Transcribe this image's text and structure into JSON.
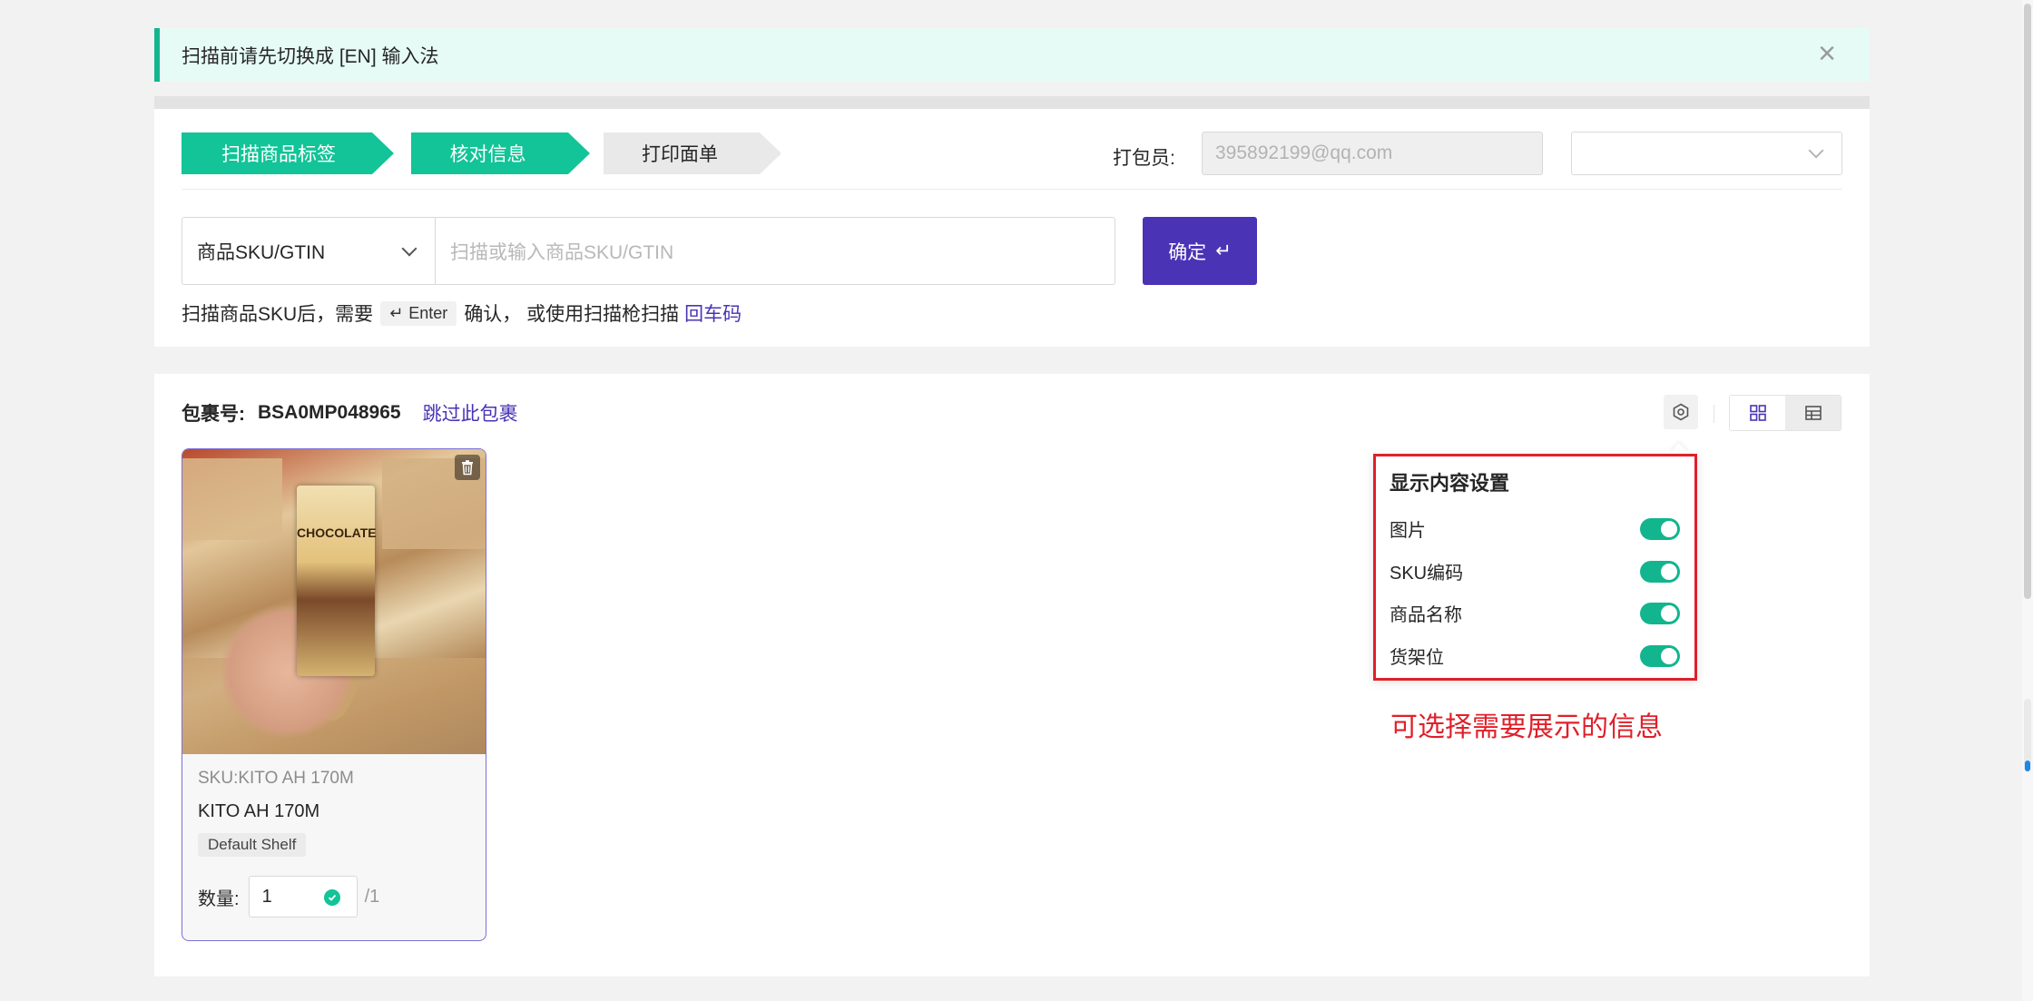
{
  "banner": {
    "text": "扫描前请先切换成 [EN] 输入法",
    "close": "×"
  },
  "steps": [
    {
      "label": "扫描商品标签",
      "state": "done"
    },
    {
      "label": "核对信息",
      "state": "active"
    },
    {
      "label": "打印面单",
      "state": "pending"
    }
  ],
  "packer": {
    "label": "打包员:",
    "value": "395892199@qq.com",
    "select_value": ""
  },
  "scan": {
    "type_select": "商品SKU/GTIN",
    "placeholder": "扫描或输入商品SKU/GTIN",
    "confirm_label": "确定",
    "confirm_icon": "↵",
    "hint_prefix": "扫描商品SKU后，需要",
    "hint_key": "Enter",
    "hint_key_icon": "↵",
    "hint_mid": "确认， 或使用扫描枪扫描",
    "hint_link": "回车码"
  },
  "package": {
    "label": "包裹号:",
    "number": "BSA0MP048965",
    "skip": "跳过此包裹"
  },
  "product": {
    "image_text": "CHOCOLATE",
    "sku_label": "SKU:",
    "sku": "KITO AH 170M",
    "name": "KITO AH 170M",
    "shelf": "Default Shelf",
    "qty_label": "数量:",
    "qty": "1",
    "qty_total": "/1"
  },
  "display_settings": {
    "title": "显示内容设置",
    "options": [
      {
        "label": "图片",
        "on": true
      },
      {
        "label": "SKU编码",
        "on": true
      },
      {
        "label": "商品名称",
        "on": true
      },
      {
        "label": "货架位",
        "on": true
      }
    ]
  },
  "annotation": "可选择需要展示的信息",
  "colors": {
    "primary": "#4a33b5",
    "step_green": "#12c497",
    "toggle_green": "#12b58e",
    "annotation_red": "#e0202a"
  }
}
